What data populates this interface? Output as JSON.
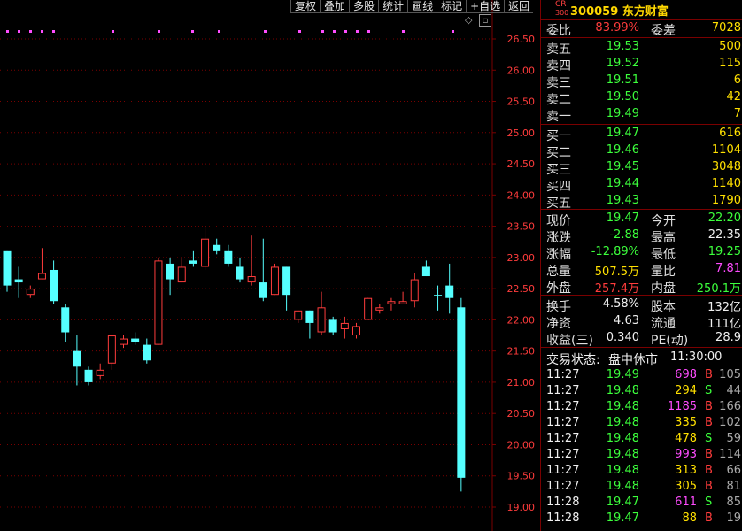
{
  "toolbar": {
    "buttons": [
      "复权",
      "叠加",
      "多股",
      "统计",
      "画线",
      "标记",
      "+自选",
      "返回"
    ]
  },
  "colors": {
    "up": "#ff3c3c",
    "down": "#55ffff",
    "grid": "#7a0000",
    "axis_text": "#ff3c3c"
  },
  "chart_data": {
    "type": "candlestick",
    "y_ticks": [
      "26.50",
      "26.00",
      "25.50",
      "25.00",
      "24.50",
      "24.00",
      "23.50",
      "23.00",
      "22.50",
      "22.00",
      "21.50",
      "21.00",
      "20.50",
      "20.00",
      "19.50",
      "19.00"
    ],
    "ylim": [
      18.9,
      26.6
    ],
    "candles": [
      {
        "o": 23.1,
        "h": 23.1,
        "l": 22.45,
        "c": 22.55
      },
      {
        "o": 22.65,
        "h": 22.85,
        "l": 22.35,
        "c": 22.6
      },
      {
        "o": 22.4,
        "h": 22.55,
        "l": 22.35,
        "c": 22.5
      },
      {
        "o": 22.65,
        "h": 23.15,
        "l": 22.65,
        "c": 22.75
      },
      {
        "o": 22.8,
        "h": 22.95,
        "l": 22.25,
        "c": 22.3
      },
      {
        "o": 22.2,
        "h": 22.25,
        "l": 21.65,
        "c": 21.8
      },
      {
        "o": 21.5,
        "h": 21.75,
        "l": 20.95,
        "c": 21.25
      },
      {
        "o": 21.2,
        "h": 21.25,
        "l": 20.95,
        "c": 21.0
      },
      {
        "o": 21.1,
        "h": 21.3,
        "l": 21.05,
        "c": 21.2
      },
      {
        "o": 21.3,
        "h": 21.75,
        "l": 21.2,
        "c": 21.75
      },
      {
        "o": 21.6,
        "h": 21.75,
        "l": 21.55,
        "c": 21.7
      },
      {
        "o": 21.7,
        "h": 21.8,
        "l": 21.6,
        "c": 21.65
      },
      {
        "o": 21.6,
        "h": 21.7,
        "l": 21.3,
        "c": 21.35
      },
      {
        "o": 21.6,
        "h": 23.0,
        "l": 21.6,
        "c": 22.95
      },
      {
        "o": 22.9,
        "h": 23.0,
        "l": 22.4,
        "c": 22.65
      },
      {
        "o": 22.6,
        "h": 23.0,
        "l": 22.6,
        "c": 22.85
      },
      {
        "o": 22.95,
        "h": 23.1,
        "l": 22.85,
        "c": 22.9
      },
      {
        "o": 22.85,
        "h": 23.5,
        "l": 22.8,
        "c": 23.3
      },
      {
        "o": 23.2,
        "h": 23.3,
        "l": 23.05,
        "c": 23.1
      },
      {
        "o": 23.1,
        "h": 23.2,
        "l": 22.85,
        "c": 22.9
      },
      {
        "o": 22.85,
        "h": 23.0,
        "l": 22.6,
        "c": 22.65
      },
      {
        "o": 22.6,
        "h": 23.35,
        "l": 22.55,
        "c": 22.7
      },
      {
        "o": 22.6,
        "h": 23.3,
        "l": 22.3,
        "c": 22.35
      },
      {
        "o": 22.4,
        "h": 22.9,
        "l": 22.4,
        "c": 22.85
      },
      {
        "o": 22.85,
        "h": 22.85,
        "l": 22.15,
        "c": 22.4
      },
      {
        "o": 22.0,
        "h": 22.15,
        "l": 21.95,
        "c": 22.15
      },
      {
        "o": 22.15,
        "h": 22.15,
        "l": 21.7,
        "c": 21.95
      },
      {
        "o": 21.8,
        "h": 22.45,
        "l": 21.75,
        "c": 22.2
      },
      {
        "o": 22.0,
        "h": 22.05,
        "l": 21.75,
        "c": 21.8
      },
      {
        "o": 21.85,
        "h": 22.05,
        "l": 21.7,
        "c": 21.95
      },
      {
        "o": 21.75,
        "h": 21.95,
        "l": 21.7,
        "c": 21.9
      },
      {
        "o": 22.0,
        "h": 22.35,
        "l": 22.0,
        "c": 22.35
      },
      {
        "o": 22.15,
        "h": 22.25,
        "l": 22.1,
        "c": 22.2
      },
      {
        "o": 22.25,
        "h": 22.35,
        "l": 22.15,
        "c": 22.3
      },
      {
        "o": 22.25,
        "h": 22.45,
        "l": 22.25,
        "c": 22.3
      },
      {
        "o": 22.3,
        "h": 22.75,
        "l": 22.2,
        "c": 22.65
      },
      {
        "o": 22.85,
        "h": 22.95,
        "l": 22.7,
        "c": 22.7
      },
      {
        "o": 22.4,
        "h": 22.55,
        "l": 22.15,
        "c": 22.4
      },
      {
        "o": 22.55,
        "h": 22.9,
        "l": 22.1,
        "c": 22.35
      },
      {
        "o": 22.2,
        "h": 22.35,
        "l": 19.25,
        "c": 19.47
      }
    ],
    "markers_count": 18
  },
  "stock": {
    "code_prefix": "CR",
    "index_tag": "300",
    "code": "300059",
    "name": "东方财富"
  },
  "ratio": {
    "wb_label": "委比",
    "wb_value": "83.99%",
    "wc_label": "委差",
    "wc_value": "7028"
  },
  "asks": [
    {
      "label": "卖五",
      "price": "19.53",
      "vol": "500"
    },
    {
      "label": "卖四",
      "price": "19.52",
      "vol": "115"
    },
    {
      "label": "卖三",
      "price": "19.51",
      "vol": "6"
    },
    {
      "label": "卖二",
      "price": "19.50",
      "vol": "42"
    },
    {
      "label": "卖一",
      "price": "19.49",
      "vol": "7"
    }
  ],
  "bids": [
    {
      "label": "买一",
      "price": "19.47",
      "vol": "616"
    },
    {
      "label": "买二",
      "price": "19.46",
      "vol": "1104"
    },
    {
      "label": "买三",
      "price": "19.45",
      "vol": "3048"
    },
    {
      "label": "买四",
      "price": "19.44",
      "vol": "1140"
    },
    {
      "label": "买五",
      "price": "19.43",
      "vol": "1790"
    }
  ],
  "quote": [
    {
      "l1": "现价",
      "v1": "19.47",
      "c1": "green",
      "l2": "今开",
      "v2": "22.20",
      "c2": "green"
    },
    {
      "l1": "涨跌",
      "v1": "-2.88",
      "c1": "green",
      "l2": "最高",
      "v2": "22.35",
      "c2": "white"
    },
    {
      "l1": "涨幅",
      "v1": "-12.89%",
      "c1": "green",
      "l2": "最低",
      "v2": "19.25",
      "c2": "green"
    },
    {
      "l1": "总量",
      "v1": "507.5万",
      "c1": "yellow",
      "l2": "量比",
      "v2": "7.81",
      "c2": "magenta"
    },
    {
      "l1": "外盘",
      "v1": "257.4万",
      "c1": "red",
      "l2": "内盘",
      "v2": "250.1万",
      "c2": "green"
    }
  ],
  "stats": [
    {
      "l1": "换手",
      "v1": "4.58%",
      "l2": "股本",
      "v2": "132亿"
    },
    {
      "l1": "净资",
      "v1": "4.63",
      "l2": "流通",
      "v2": "111亿"
    },
    {
      "l1": "收益(三)",
      "v1": "0.340",
      "l2": "PE(动)",
      "v2": "28.9"
    }
  ],
  "status": {
    "label": "交易状态:",
    "value": "盘中休市",
    "time": "11:30:00"
  },
  "ticks": [
    {
      "time": "11:27",
      "price": "19.49",
      "vol": "698",
      "vc": "magenta",
      "side": "B",
      "n": "105"
    },
    {
      "time": "11:27",
      "price": "19.48",
      "vol": "294",
      "vc": "yellow",
      "side": "S",
      "n": "44"
    },
    {
      "time": "11:27",
      "price": "19.48",
      "vol": "1185",
      "vc": "magenta",
      "side": "B",
      "n": "166"
    },
    {
      "time": "11:27",
      "price": "19.48",
      "vol": "335",
      "vc": "yellow",
      "side": "B",
      "n": "102"
    },
    {
      "time": "11:27",
      "price": "19.48",
      "vol": "478",
      "vc": "yellow",
      "side": "S",
      "n": "59"
    },
    {
      "time": "11:27",
      "price": "19.48",
      "vol": "993",
      "vc": "magenta",
      "side": "B",
      "n": "114"
    },
    {
      "time": "11:27",
      "price": "19.48",
      "vol": "313",
      "vc": "yellow",
      "side": "B",
      "n": "66"
    },
    {
      "time": "11:27",
      "price": "19.48",
      "vol": "305",
      "vc": "yellow",
      "side": "B",
      "n": "81"
    },
    {
      "time": "11:28",
      "price": "19.47",
      "vol": "611",
      "vc": "magenta",
      "side": "S",
      "n": "85"
    },
    {
      "time": "11:28",
      "price": "19.47",
      "vol": "88",
      "vc": "yellow",
      "side": "B",
      "n": "19"
    }
  ]
}
